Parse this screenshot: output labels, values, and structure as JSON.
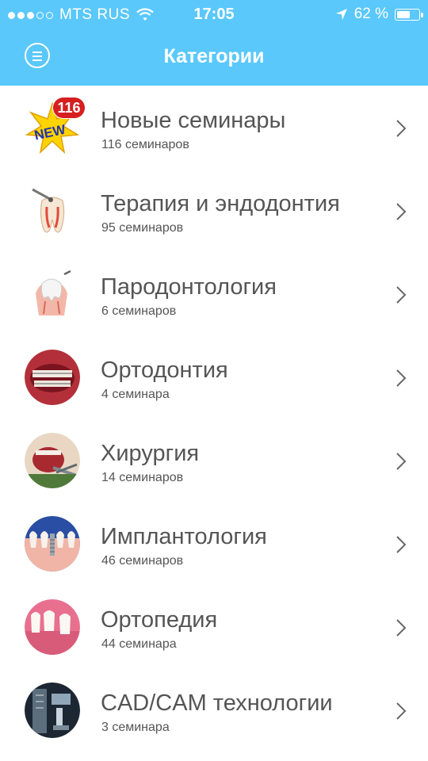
{
  "status": {
    "carrier": "MTS RUS",
    "time": "17:05",
    "battery_percent_text": "62 %",
    "battery_level": 0.62,
    "signal_filled": 3,
    "signal_total": 5
  },
  "nav": {
    "title": "Категории"
  },
  "colors": {
    "header": "#5AC8FB",
    "text": "#555555",
    "badge": "#d61f1f"
  },
  "categories": [
    {
      "title": "Новые семинары",
      "subtitle": "116 семинаров",
      "badge": "116",
      "icon": "new-star-icon"
    },
    {
      "title": "Терапия и эндодонтия",
      "subtitle": "95 семинаров",
      "icon": "tooth-drill-icon"
    },
    {
      "title": "Пародонтология",
      "subtitle": "6 семинаров",
      "icon": "tooth-gum-icon"
    },
    {
      "title": "Ортодонтия",
      "subtitle": "4 семинара",
      "icon": "braces-icon"
    },
    {
      "title": "Хирургия",
      "subtitle": "14 семинаров",
      "icon": "surgery-icon"
    },
    {
      "title": "Имплантология",
      "subtitle": "46 семинаров",
      "icon": "implant-icon"
    },
    {
      "title": "Ортопедия",
      "subtitle": "44 семинара",
      "icon": "orthopedics-icon"
    },
    {
      "title": "CAD/CAM технологии",
      "subtitle": "3 семинара",
      "icon": "cad-cam-icon"
    }
  ]
}
